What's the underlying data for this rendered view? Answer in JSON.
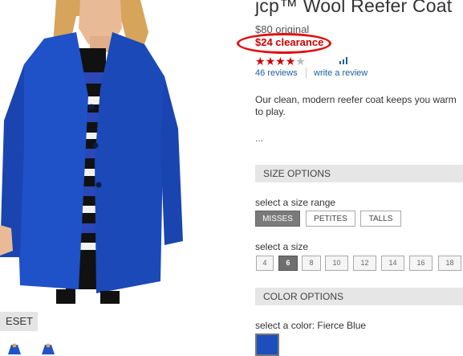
{
  "product": {
    "title": "jcp™ Wool Reefer Coat",
    "original_price": "$80 original",
    "clearance_price": "$24 clearance",
    "rating": 4,
    "rating_max": 5,
    "reviews_link": "46 reviews",
    "write_review_link": "write a review",
    "description": "Our clean, modern reefer coat keeps you warm to play.",
    "more": "..."
  },
  "image": {
    "reset_label": "ESET",
    "thumbnails": [
      "coat-thumb-front",
      "coat-thumb-side",
      "coat-thumb-back"
    ]
  },
  "size_options": {
    "header": "SIZE OPTIONS",
    "range_label": "select a size range",
    "ranges": [
      {
        "label": "MISSES",
        "selected": true
      },
      {
        "label": "PETITES",
        "selected": false
      },
      {
        "label": "TALLS",
        "selected": false
      }
    ],
    "size_label": "select a size",
    "sizes": [
      {
        "label": "4",
        "selected": false
      },
      {
        "label": "6",
        "selected": true
      },
      {
        "label": "8",
        "selected": false
      },
      {
        "label": "10",
        "selected": false
      },
      {
        "label": "12",
        "selected": false
      },
      {
        "label": "14",
        "selected": false
      },
      {
        "label": "16",
        "selected": false
      },
      {
        "label": "18",
        "selected": false
      }
    ]
  },
  "color_options": {
    "header": "COLOR OPTIONS",
    "label": "select a color: Fierce Blue",
    "swatch_color": "#1c4fbd"
  },
  "colors": {
    "coat": "#1f52c8",
    "clearance": "#cc0000",
    "link": "#1b5e9e"
  }
}
